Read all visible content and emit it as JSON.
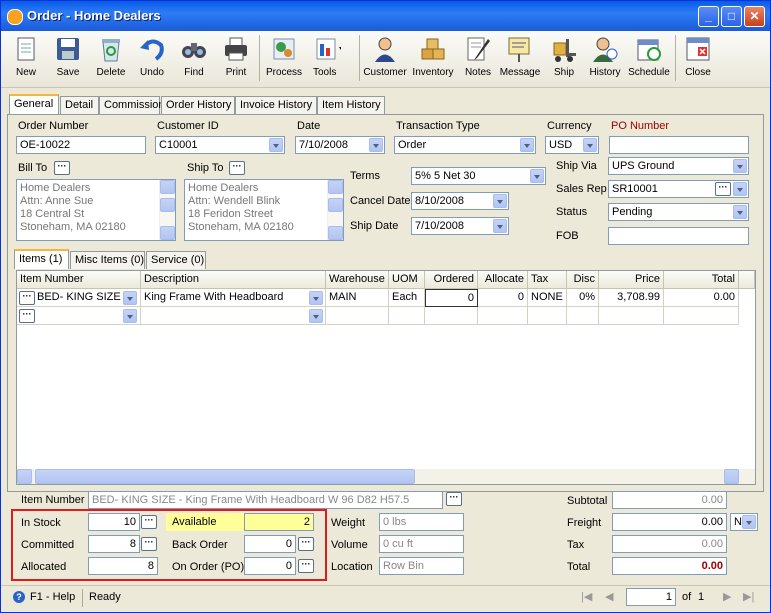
{
  "window": {
    "title": "Order - Home Dealers"
  },
  "toolbar": {
    "items": [
      "New",
      "Save",
      "Delete",
      "Undo",
      "Find",
      "Print",
      "Process",
      "Tools",
      "Customer",
      "Inventory",
      "Notes",
      "Message",
      "Ship",
      "History",
      "Schedule",
      "Close"
    ]
  },
  "tabs": [
    "General",
    "Detail",
    "Commission",
    "Order History",
    "Invoice History",
    "Item History"
  ],
  "header": {
    "order_number_label": "Order Number",
    "order_number": "OE-10022",
    "customer_id_label": "Customer ID",
    "customer_id": "C10001",
    "date_label": "Date",
    "date": "7/10/2008",
    "transaction_type_label": "Transaction Type",
    "transaction_type": "Order",
    "currency_label": "Currency",
    "currency": "USD",
    "po_number_label": "PO Number",
    "po_number": "",
    "bill_to_label": "Bill To",
    "bill_to": [
      "Home Dealers",
      "Attn: Anne Sue",
      "18 Central St",
      "Stoneham, MA 02180"
    ],
    "ship_to_label": "Ship To",
    "ship_to": [
      "Home Dealers",
      "Attn: Wendell Blink",
      "18 Feridon Street",
      "Stoneham, MA 02180"
    ],
    "terms_label": "Terms",
    "terms": "5% 5 Net 30",
    "cancel_date_label": "Cancel Date",
    "cancel_date": "8/10/2008",
    "ship_date_label": "Ship Date",
    "ship_date": "7/10/2008",
    "ship_via_label": "Ship Via",
    "ship_via": "UPS Ground",
    "sales_rep_label": "Sales Rep",
    "sales_rep": "SR10001",
    "status_label": "Status",
    "status": "Pending",
    "fob_label": "FOB",
    "fob": ""
  },
  "item_tabs": [
    "Items (1)",
    "Misc Items (0)",
    "Service (0)"
  ],
  "grid": {
    "columns": [
      "Item Number",
      "Description",
      "Warehouse",
      "UOM",
      "Ordered",
      "Allocate",
      "Tax",
      "Disc",
      "Price",
      "Total"
    ],
    "rows": [
      {
        "item_number": "BED- KING SIZE",
        "description": "King Frame With  Headboard",
        "warehouse": "MAIN",
        "uom": "Each",
        "ordered": "0",
        "allocate": "0",
        "tax": "NONE",
        "disc": "0%",
        "price": "3,708.99",
        "total": "0.00"
      }
    ]
  },
  "footer": {
    "item_number_label": "Item Number",
    "item_number": "BED- KING SIZE - King Frame With  Headboard W 96 D82  H57.5",
    "in_stock_label": "In Stock",
    "in_stock": "10",
    "committed_label": "Committed",
    "committed": "8",
    "allocated_label": "Allocated",
    "allocated": "8",
    "available_label": "Available",
    "available": "2",
    "back_order_label": "Back Order",
    "back_order": "0",
    "on_order_label": "On Order (PO)",
    "on_order": "0",
    "weight_label": "Weight",
    "weight": "0 lbs",
    "volume_label": "Volume",
    "volume": "0 cu ft",
    "location_label": "Location",
    "location": "Row  Bin",
    "subtotal_label": "Subtotal",
    "subtotal": "0.00",
    "freight_label": "Freight",
    "freight": "0.00",
    "freight_code": "N",
    "tax_label": "Tax",
    "tax": "0.00",
    "total_label": "Total",
    "total": "0.00"
  },
  "status": {
    "help": "F1 - Help",
    "text": "Ready",
    "page": "1",
    "of": "of",
    "pages": "1"
  },
  "colors": {
    "title_bar": "#0a5ce8",
    "highlight": "#ffff99",
    "red_box": "#e11a1a",
    "po_label": "#a00000"
  }
}
